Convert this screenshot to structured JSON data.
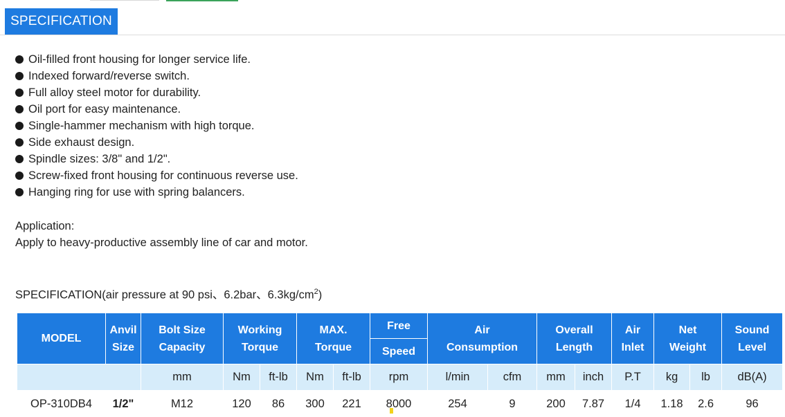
{
  "tabs": {
    "active_label": "SPECIFICATION"
  },
  "features": [
    "Oil-filled front housing for longer service life.",
    "Indexed forward/reverse switch.",
    "Full alloy steel motor for durability.",
    "Oil port for easy maintenance.",
    "Single-hammer mechanism with high torque.",
    "Side exhaust design.",
    "Spindle sizes: 3/8\" and 1/2\".",
    "Screw-fixed front housing for continuous reverse use.",
    "Hanging ring for use with spring balancers."
  ],
  "application": {
    "label": "Application:",
    "text": "Apply to heavy-productive assembly line of car and motor."
  },
  "spec_heading": {
    "text": "SPECIFICATION(air pressure at 90 psi、6.2bar、6.3kg/cm",
    "sup": "2",
    "close": ")"
  },
  "table": {
    "headers": {
      "model": "MODEL",
      "anvil_1": "Anvil",
      "anvil_2": "Size",
      "bolt_1": "Bolt Size",
      "bolt_2": "Capacity",
      "working_1": "Working",
      "working_2": "Torque",
      "max_1": "MAX.",
      "max_2": "Torque",
      "free_1": "Free",
      "free_2": "Speed",
      "air_1": "Air",
      "air_2": "Consumption",
      "overall_1": "Overall",
      "overall_2": "Length",
      "inlet_1": "Air",
      "inlet_2": "Inlet",
      "net_1": "Net",
      "net_2": "Weight",
      "sound_1": "Sound",
      "sound_2": "Level"
    },
    "units": [
      "mm",
      "Nm",
      "ft-lb",
      "Nm",
      "ft-lb",
      "rpm",
      "l/min",
      "cfm",
      "mm",
      "inch",
      "P.T",
      "kg",
      "lb",
      "dB(A)"
    ],
    "row": {
      "model": "OP-310DB4",
      "anvil": "1/2\"",
      "bolt": "M12",
      "working_nm": "120",
      "working_ftlb": "86",
      "max_nm": "300",
      "max_ftlb": "221",
      "speed": "8000",
      "air_lmin": "254",
      "air_cfm": "9",
      "length_mm": "200",
      "length_inch": "7.87",
      "inlet": "1/4",
      "weight_kg": "1.18",
      "weight_lb": "2.6",
      "sound": "96"
    }
  }
}
